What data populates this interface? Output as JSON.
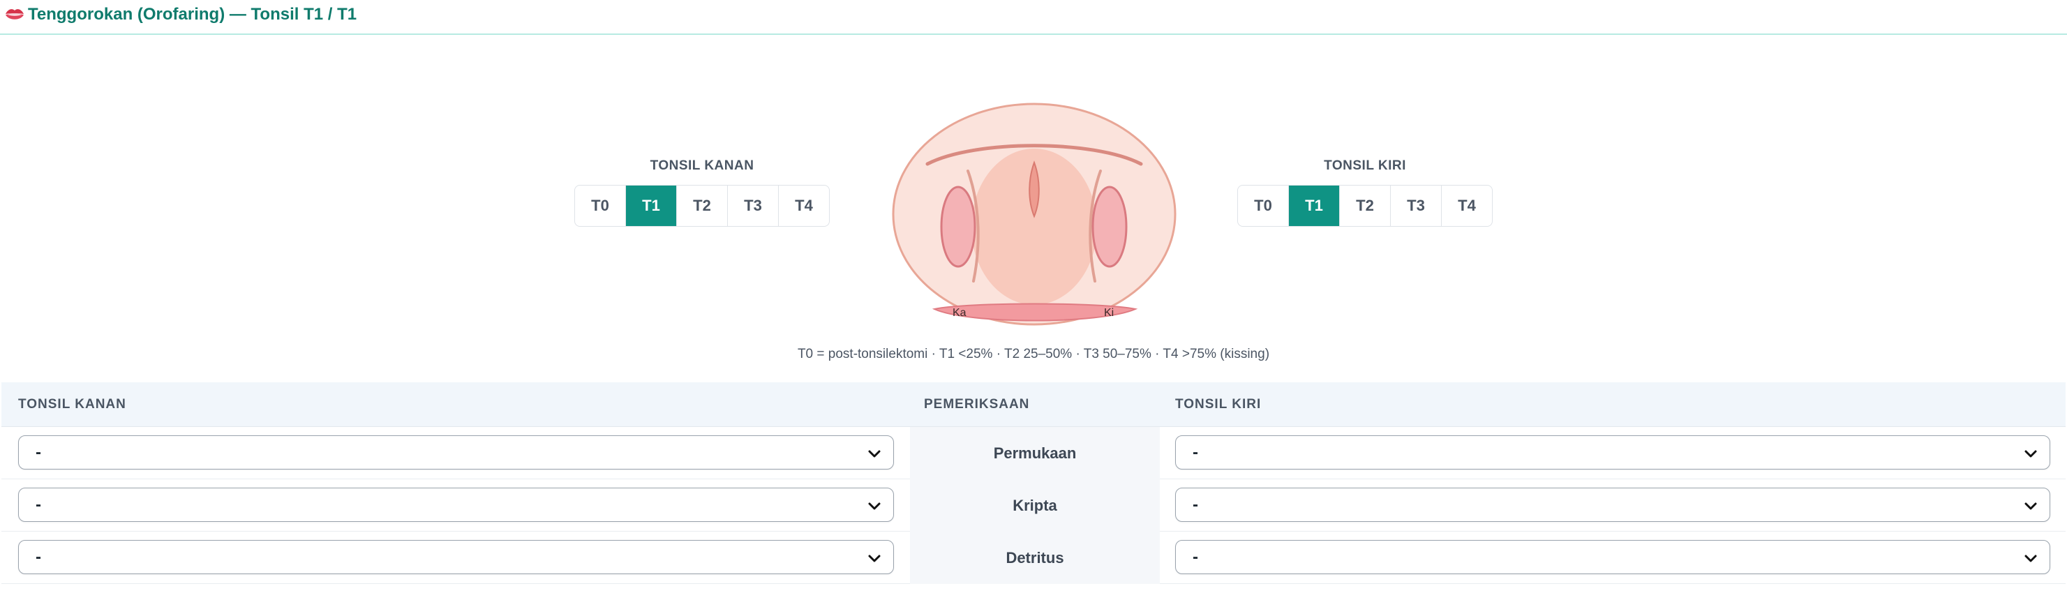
{
  "header": {
    "icon": "mouth-lips-icon",
    "title": "Tenggorokan (Orofaring) — Tonsil T1 / T1"
  },
  "tonsil_right": {
    "label": "TONSIL KANAN",
    "options": [
      "T0",
      "T1",
      "T2",
      "T3",
      "T4"
    ],
    "selected": "T1"
  },
  "tonsil_left": {
    "label": "TONSIL KIRI",
    "options": [
      "T0",
      "T1",
      "T2",
      "T3",
      "T4"
    ],
    "selected": "T1"
  },
  "diagram": {
    "label_right": "Ka",
    "label_left": "Ki",
    "colors": {
      "mouth_fill": "#fbe3dc",
      "mouth_stroke": "#e8a696",
      "tonsil_fill": "#f4b2b5",
      "tonsil_stroke": "#d97a80",
      "tongue_fill": "#f29a9f"
    }
  },
  "legend": "T0 = post-tonsilektomi · T1 <25% · T2 25–50% · T3 50–75% · T4 >75% (kissing)",
  "table": {
    "headers": {
      "right": "TONSIL KANAN",
      "middle": "PEMERIKSAAN",
      "left": "TONSIL KIRI"
    },
    "rows": [
      {
        "exam": "Permukaan",
        "right_value": "-",
        "left_value": "-"
      },
      {
        "exam": "Kripta",
        "right_value": "-",
        "left_value": "-"
      },
      {
        "exam": "Detritus",
        "right_value": "-",
        "left_value": "-"
      }
    ]
  },
  "colors": {
    "accent": "#0f9384",
    "title": "#0f7b6c",
    "header_border": "#b7ebe2"
  }
}
